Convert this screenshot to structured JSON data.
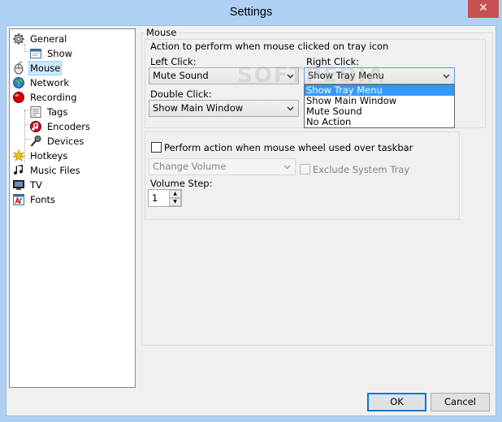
{
  "window": {
    "title": "Settings",
    "close_glyph": "✕"
  },
  "tree": {
    "items": [
      {
        "label": "General",
        "icon": "gear-icon"
      },
      {
        "label": "Show",
        "icon": "window-icon"
      },
      {
        "label": "Mouse",
        "icon": "mouse-icon"
      },
      {
        "label": "Network",
        "icon": "globe-icon"
      },
      {
        "label": "Recording",
        "icon": "record-icon"
      },
      {
        "label": "Tags",
        "icon": "tags-icon"
      },
      {
        "label": "Encoders",
        "icon": "encoder-icon"
      },
      {
        "label": "Devices",
        "icon": "microphone-icon"
      },
      {
        "label": "Hotkeys",
        "icon": "hotkeys-icon"
      },
      {
        "label": "Music Files",
        "icon": "music-note-icon"
      },
      {
        "label": "TV",
        "icon": "tv-icon"
      },
      {
        "label": "Fonts",
        "icon": "fonts-icon"
      }
    ],
    "selected": "Mouse"
  },
  "mouse": {
    "group_title": "Mouse",
    "tray_group_title": "Action to perform when mouse clicked on tray icon",
    "left_click_label": "Left Click:",
    "left_click_value": "Mute Sound",
    "right_click_label": "Right Click:",
    "right_click_value": "Show Tray Menu",
    "double_click_label": "Double Click:",
    "double_click_value": "Show Main Window",
    "dropdown_options": [
      "Show Tray Menu",
      "Show Main Window",
      "Mute Sound",
      "No Action"
    ],
    "wheel_checkbox_label": "Perform action when mouse wheel used over taskbar",
    "wheel_checked": false,
    "wheel_action_value": "Change Volume",
    "exclude_tray_label": "Exclude System Tray",
    "volume_step_label": "Volume Step:",
    "volume_step_value": "1"
  },
  "buttons": {
    "ok": "OK",
    "cancel": "Cancel"
  },
  "watermark": "SOFTPEDIA",
  "colors": {
    "accent": "#0078d7",
    "highlight": "#3399ff",
    "close": "#c75050",
    "frame": "#aed0f5"
  }
}
